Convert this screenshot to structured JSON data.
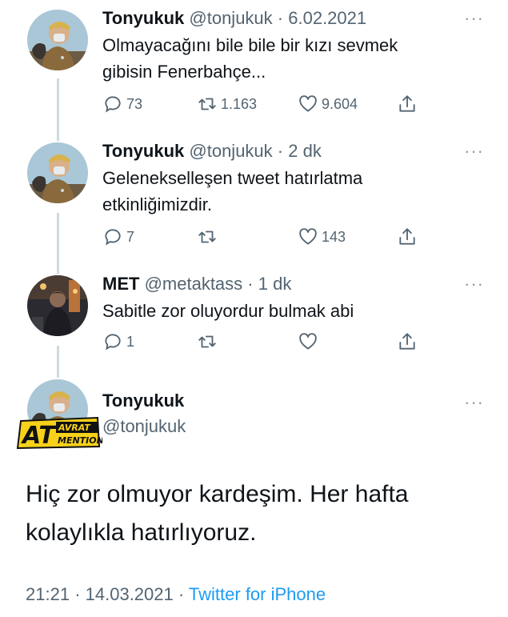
{
  "tweets": [
    {
      "name": "Tonyukuk",
      "handle": "@tonjukuk",
      "dot": "·",
      "time": "6.02.2021",
      "more": "···",
      "text_lines": [
        "Olmayacağını bile bile bir kızı sevmek",
        "gibisin Fenerbahçe..."
      ],
      "replies": "73",
      "retweets": "1.163",
      "likes": "9.604"
    },
    {
      "name": "Tonyukuk",
      "handle": "@tonjukuk",
      "dot": "·",
      "time": "2 dk",
      "more": "···",
      "text_lines": [
        "Gelenekselleşen tweet hatırlatma",
        "etkinliğimizdir."
      ],
      "replies": "7",
      "retweets": "",
      "likes": "143"
    },
    {
      "name": "MET",
      "handle": "@metaktass",
      "dot": "·",
      "time": "1 dk",
      "more": "···",
      "text_lines": [
        "Sabitle zor oluyordur bulmak abi"
      ],
      "replies": "1",
      "retweets": "",
      "likes": ""
    }
  ],
  "main_tweet": {
    "name": "Tonyukuk",
    "handle": "@tonjukuk",
    "more": "···",
    "text_lines": [
      "Hiç zor olmuyor kardeşim. Her hafta",
      "kolaylıkla hatırlıyoruz."
    ],
    "time": "21:21",
    "date": "14.03.2021",
    "dot": "·",
    "source": "Twitter for iPhone"
  },
  "watermark": {
    "big": "AT",
    "top": "AVRAT",
    "bottom": "MENTION"
  },
  "icons": {
    "reply": "reply-icon",
    "retweet": "retweet-icon",
    "like": "heart-icon",
    "share": "share-icon",
    "more": "more-icon"
  },
  "colors": {
    "link": "#1d9bf0",
    "secondary_text": "#536471",
    "thread_line": "#cfd9de",
    "badge_yellow": "#f7d11a"
  }
}
